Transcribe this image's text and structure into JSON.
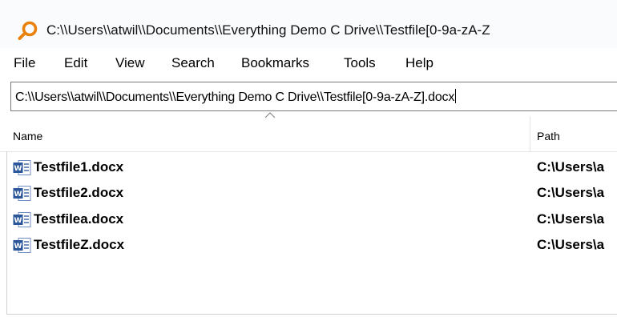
{
  "window": {
    "title": "C:\\\\Users\\\\atwil\\\\Documents\\\\Everything Demo C Drive\\\\Testfile[0-9a-zA-Z"
  },
  "menu": {
    "items": [
      "File",
      "Edit",
      "View",
      "Search",
      "Bookmarks",
      "Tools",
      "Help"
    ]
  },
  "search": {
    "value": "C:\\\\Users\\\\atwil\\\\Documents\\\\Everything Demo C Drive\\\\Testfile[0-9a-zA-Z].docx"
  },
  "columns": {
    "name": "Name",
    "path": "Path"
  },
  "results": [
    {
      "name": "Testfile1.docx",
      "path": "C:\\Users\\a"
    },
    {
      "name": "Testfile2.docx",
      "path": "C:\\Users\\a"
    },
    {
      "name": "Testfilea.docx",
      "path": "C:\\Users\\a"
    },
    {
      "name": "TestfileZ.docx",
      "path": "C:\\Users\\a"
    }
  ],
  "colors": {
    "accent": "#e8820c",
    "word_blue": "#2b579a"
  }
}
